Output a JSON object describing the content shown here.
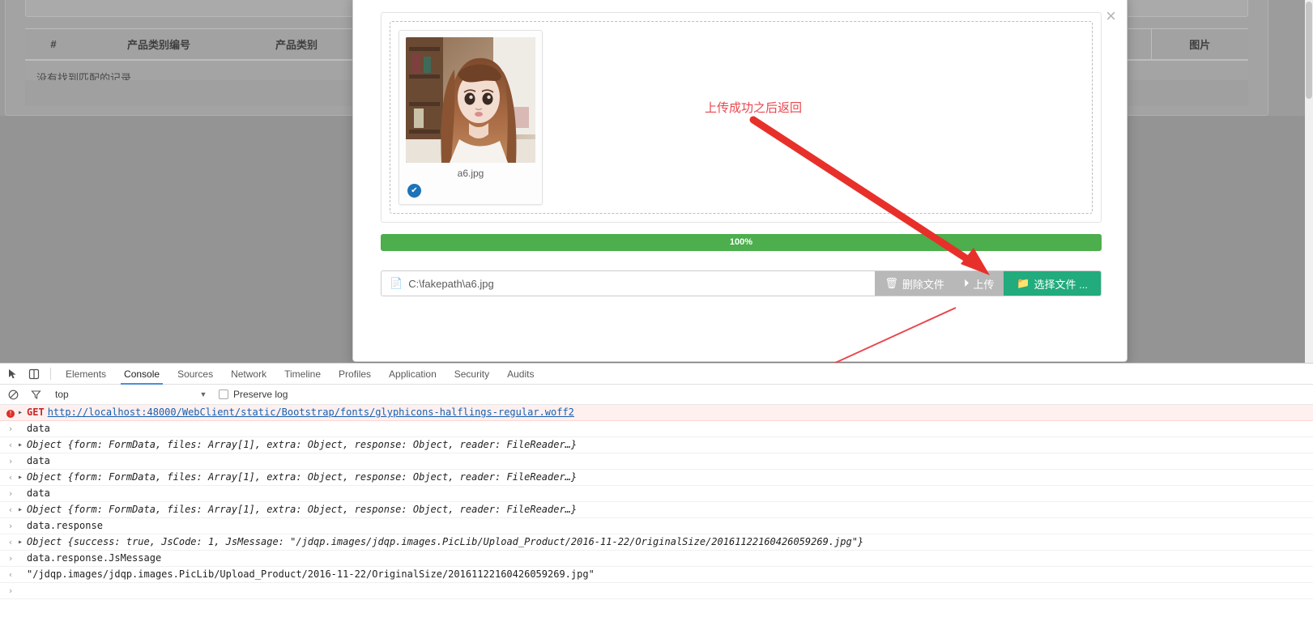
{
  "background": {
    "table": {
      "headers": [
        "#",
        "产品类别编号",
        "产品类别",
        "",
        "图片"
      ],
      "empty_text": "没有找到匹配的记录"
    }
  },
  "modal": {
    "close_label": "×",
    "uploader": {
      "thumbnail": {
        "filename": "a6.jpg",
        "badge_icon": "check-circle-icon"
      },
      "progress": {
        "label": "100%",
        "percent": 100,
        "color": "#4cae4c"
      },
      "file_input": {
        "value": "C:\\fakepath\\a6.jpg",
        "icon": "document-icon"
      },
      "buttons": {
        "delete": {
          "label": "删除文件",
          "icon": "trash-icon"
        },
        "upload": {
          "label": "上传",
          "icon": "upload-circle-icon"
        },
        "choose": {
          "label": "选择文件 ...",
          "icon": "folder-open-icon",
          "color": "#22ab7d"
        }
      }
    }
  },
  "annotations": {
    "upload_success": "上传成功之后返回",
    "color": "#e8474f"
  },
  "devtools": {
    "tabs": [
      {
        "label": "Elements",
        "active": false
      },
      {
        "label": "Console",
        "active": true
      },
      {
        "label": "Sources",
        "active": false
      },
      {
        "label": "Network",
        "active": false
      },
      {
        "label": "Timeline",
        "active": false
      },
      {
        "label": "Profiles",
        "active": false
      },
      {
        "label": "Application",
        "active": false
      },
      {
        "label": "Security",
        "active": false
      },
      {
        "label": "Audits",
        "active": false
      }
    ],
    "icons": {
      "inspect": "inspect-cursor-icon",
      "device": "device-toolbar-icon",
      "clear": "clear-console-icon",
      "filter": "filter-funnel-icon",
      "caret": "chevron-down-icon"
    },
    "filterbar": {
      "context": "top",
      "preserve_log": "Preserve log",
      "preserve_log_checked": false
    },
    "console_rows": [
      {
        "kind": "error-network",
        "gutter": "error",
        "expandable": true,
        "method": "GET",
        "url": "http://localhost:48000/WebClient/static/Bootstrap/fonts/glyphicons-halflings-regular.woff2"
      },
      {
        "kind": "input",
        "gutter": "input",
        "text": "data"
      },
      {
        "kind": "object",
        "gutter": "output",
        "expandable": true,
        "name": "Object",
        "preview": "{form: FormData, files: Array[1], extra: Object, response: Object, reader: FileReader…}"
      },
      {
        "kind": "input",
        "gutter": "input",
        "text": "data"
      },
      {
        "kind": "object",
        "gutter": "output",
        "expandable": true,
        "name": "Object",
        "preview": "{form: FormData, files: Array[1], extra: Object, response: Object, reader: FileReader…}"
      },
      {
        "kind": "input",
        "gutter": "input",
        "text": "data"
      },
      {
        "kind": "object",
        "gutter": "output",
        "expandable": true,
        "name": "Object",
        "preview": "{form: FormData, files: Array[1], extra: Object, response: Object, reader: FileReader…}"
      },
      {
        "kind": "input",
        "gutter": "input",
        "text": "data.response"
      },
      {
        "kind": "object",
        "gutter": "output",
        "expandable": true,
        "name": "Object",
        "preview": "{success: true, JsCode: 1, JsMessage: \"/jdqp.images/jdqp.images.PicLib/Upload_Product/2016-11-22/OriginalSize/20161122160426059269.jpg\"}"
      },
      {
        "kind": "input",
        "gutter": "input",
        "text": "data.response.JsMessage"
      },
      {
        "kind": "string-output",
        "gutter": "output",
        "text": "\"/jdqp.images/jdqp.images.PicLib/Upload_Product/2016-11-22/OriginalSize/20161122160426059269.jpg\""
      },
      {
        "kind": "prompt",
        "gutter": "input",
        "text": ""
      }
    ]
  }
}
